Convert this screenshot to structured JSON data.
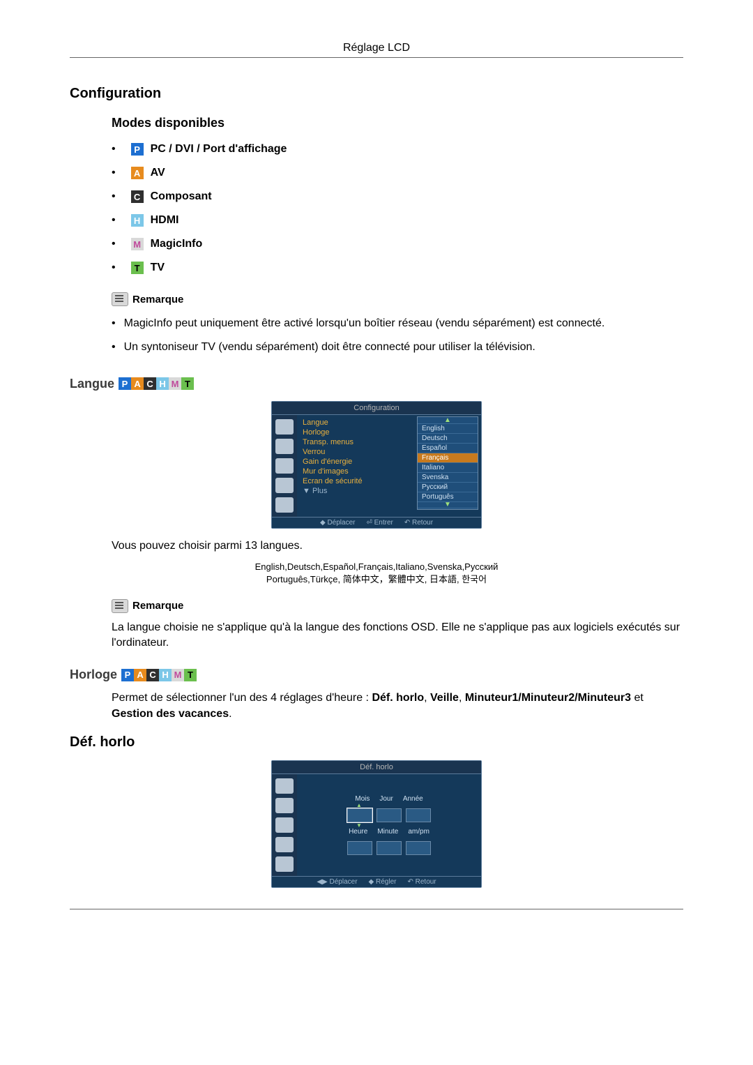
{
  "header": {
    "title": "Réglage LCD"
  },
  "config": {
    "title": "Configuration",
    "modes_title": "Modes disponibles",
    "modes": [
      {
        "badge": "P",
        "label": "PC / DVI / Port d'affichage"
      },
      {
        "badge": "A",
        "label": "AV"
      },
      {
        "badge": "C",
        "label": "Composant"
      },
      {
        "badge": "H",
        "label": "HDMI"
      },
      {
        "badge": "M",
        "label": "MagicInfo"
      },
      {
        "badge": "T",
        "label": "TV"
      }
    ],
    "remark_label": "Remarque",
    "notes": [
      "MagicInfo peut uniquement être activé lorsqu'un boîtier réseau (vendu séparément) est connecté.",
      "Un syntoniseur TV (vendu séparément) doit être connecté pour utiliser la télévision."
    ]
  },
  "langue": {
    "title": "Langue",
    "badges": [
      "P",
      "A",
      "C",
      "H",
      "M",
      "T"
    ],
    "osd": {
      "title": "Configuration",
      "items": [
        "Langue",
        "Horloge",
        "Transp. menus",
        "Verrou",
        "Gain d'énergie",
        "Mur d'images",
        "Ecran de sécurité"
      ],
      "plus": "▼ Plus",
      "dropdown": [
        "English",
        "Deutsch",
        "Español",
        "Français",
        "Italiano",
        "Svenska",
        "Русский",
        "Português"
      ],
      "dropdown_selected_index": 3,
      "footer": [
        "◆ Déplacer",
        "⏎ Entrer",
        "↶ Retour"
      ]
    },
    "intro": "Vous pouvez choisir parmi 13 langues.",
    "lang_list_line1": "English,Deutsch,Español,Français,Italiano,Svenska,Русский",
    "lang_list_line2": "Português,Türkçe, 简体中文，繁體中文, 日本語, 한국어",
    "remark_label": "Remarque",
    "note": "La langue choisie ne s'applique qu'à la langue des fonctions OSD. Elle ne s'applique pas aux logiciels exécutés sur l'ordinateur."
  },
  "horloge": {
    "title": "Horloge",
    "badges": [
      "P",
      "A",
      "C",
      "H",
      "M",
      "T"
    ],
    "text_prefix": "Permet de sélectionner l'un des 4 réglages d'heure : ",
    "bold1": "Déf. horlo",
    "sep1": ", ",
    "bold2": "Veille",
    "sep2": ", ",
    "bold3": "Minuteur1/Minuteur2/Minuteur3",
    "sep3": " et ",
    "bold4": "Gestion des vacances",
    "tail": "."
  },
  "defhorlo": {
    "title": "Déf. horlo",
    "osd": {
      "title": "Déf. horlo",
      "row1_labels": [
        "Mois",
        "Jour",
        "Année"
      ],
      "row2_labels": [
        "Heure",
        "Minute",
        "am/pm"
      ],
      "footer": [
        "◀▶ Déplacer",
        "◆ Régler",
        "↶ Retour"
      ]
    }
  }
}
